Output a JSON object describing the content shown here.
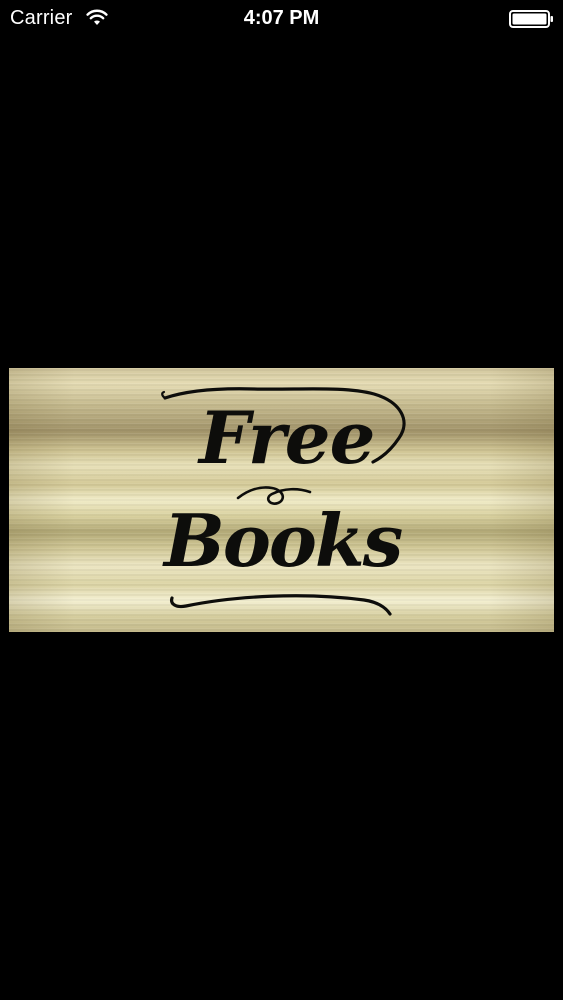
{
  "status_bar": {
    "carrier": "Carrier",
    "time": "4:07 PM",
    "icons": {
      "wifi": "wifi-icon",
      "battery": "battery-icon"
    }
  },
  "banner": {
    "line1": "Free",
    "line2": "Books",
    "colors": {
      "background": "#000000",
      "text": "#0d0d0b",
      "metal_light": "#f1ecc8",
      "metal_dark": "#a2946a"
    }
  }
}
